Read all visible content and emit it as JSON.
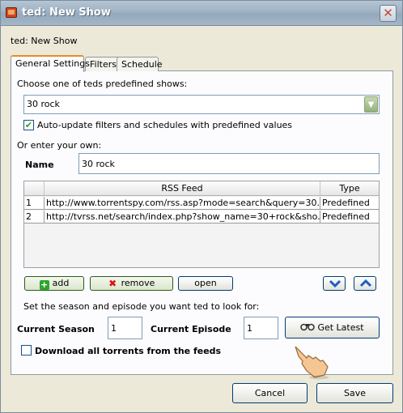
{
  "window": {
    "title": "ted: New Show",
    "close_glyph": "✕"
  },
  "dialog_heading": "ted: New Show",
  "tabs": [
    {
      "label": "General Settings",
      "active": true
    },
    {
      "label": "Filters",
      "active": false
    },
    {
      "label": "Schedule",
      "active": false
    }
  ],
  "predefined": {
    "prompt": "Choose one of teds predefined shows:",
    "selected": "30 rock",
    "auto_update_label": "Auto-update filters and schedules with predefined values",
    "auto_update_checked": true
  },
  "custom": {
    "prompt": "Or enter your own:",
    "name_label": "Name",
    "name_value": "30 rock"
  },
  "feeds": {
    "columns": [
      "",
      "RSS Feed",
      "Type"
    ],
    "rows": [
      {
        "num": "1",
        "url": "http://www.torrentspy.com/rss.asp?mode=search&query=30...",
        "type": "Predefined"
      },
      {
        "num": "2",
        "url": "http://tvrss.net/search/index.php?show_name=30+rock&sho...",
        "type": "Predefined"
      }
    ]
  },
  "feed_buttons": {
    "add": "add",
    "remove": "remove",
    "open": "open",
    "move_down_icon": "chevron-down-icon",
    "move_up_icon": "chevron-up-icon"
  },
  "episode": {
    "prompt": "Set the season and episode you want ted to look for:",
    "season_label": "Current Season",
    "season_value": "1",
    "episode_label": "Current Episode",
    "episode_value": "1",
    "get_latest": "Get Latest",
    "download_all_label": "Download all torrents from the feeds",
    "download_all_checked": false
  },
  "footer": {
    "cancel": "Cancel",
    "save": "Save"
  },
  "colors": {
    "tab_accent": "#e68b2c",
    "check_green": "#21a121",
    "arrow_blue": "#1d5fc2"
  }
}
